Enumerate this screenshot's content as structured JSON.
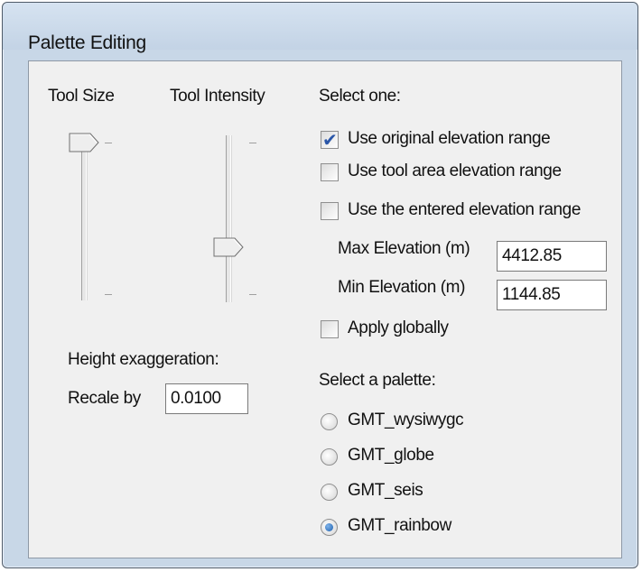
{
  "window": {
    "title": "Palette Editing"
  },
  "sliders": {
    "tool_size": {
      "label": "Tool Size",
      "level": 1.0
    },
    "tool_intensity": {
      "label": "Tool Intensity",
      "level": 0.25
    }
  },
  "height": {
    "heading": "Height exaggeration:",
    "rescale_label": "Recale by",
    "rescale_value": "0.0100"
  },
  "range": {
    "heading": "Select one:",
    "options": [
      {
        "label": "Use original elevation range",
        "checked": true
      },
      {
        "label": "Use tool area elevation range",
        "checked": false
      },
      {
        "label": "Use the entered elevation range",
        "checked": false
      }
    ],
    "max_label": "Max Elevation (m)",
    "max_value": "4412.85",
    "min_label": "Min Elevation (m)",
    "min_value": "1144.85",
    "apply_globally": {
      "label": "Apply globally",
      "checked": false
    }
  },
  "palette": {
    "heading": "Select a palette:",
    "options": [
      {
        "label": "GMT_wysiwygc",
        "selected": false
      },
      {
        "label": "GMT_globe",
        "selected": false
      },
      {
        "label": "GMT_seis",
        "selected": false
      },
      {
        "label": "GMT_rainbow",
        "selected": true
      }
    ]
  },
  "colors": {
    "check_mark": "#2a56a8",
    "radio_dot": "#1c5fae",
    "window_frame": "#c8d7e7"
  }
}
